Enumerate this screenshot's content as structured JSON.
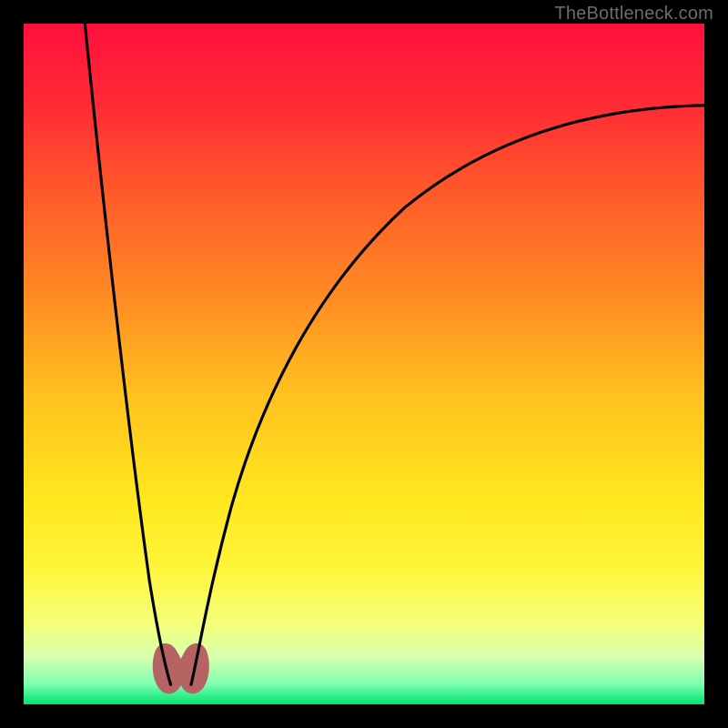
{
  "watermark": "TheBottleneck.com",
  "colors": {
    "black": "#000000",
    "curve_stroke": "#000000",
    "blob": "#b56363",
    "watermark": "#6b6b6b"
  },
  "gradient_stops": [
    {
      "offset": 0.0,
      "color": "#ff103e"
    },
    {
      "offset": 0.12,
      "color": "#ff2b35"
    },
    {
      "offset": 0.25,
      "color": "#ff5a2a"
    },
    {
      "offset": 0.4,
      "color": "#ff8b23"
    },
    {
      "offset": 0.55,
      "color": "#ffc21e"
    },
    {
      "offset": 0.7,
      "color": "#ffe81e"
    },
    {
      "offset": 0.8,
      "color": "#fff53a"
    },
    {
      "offset": 0.88,
      "color": "#f6ff78"
    },
    {
      "offset": 0.93,
      "color": "#d8ffae"
    },
    {
      "offset": 0.97,
      "color": "#7dffb0"
    },
    {
      "offset": 1.0,
      "color": "#00e472"
    }
  ],
  "chart_data": {
    "type": "line",
    "title": "",
    "xlabel": "",
    "ylabel": "",
    "xlim": [
      0,
      100
    ],
    "ylim": [
      0,
      100
    ],
    "series": [
      {
        "name": "left-branch",
        "x": [
          9,
          12.5,
          15,
          17.5,
          20,
          21.5
        ],
        "values": [
          100,
          75,
          50,
          25,
          8,
          0
        ]
      },
      {
        "name": "right-branch",
        "x": [
          24.5,
          27,
          30,
          34,
          40,
          50,
          62,
          78,
          100
        ],
        "values": [
          0,
          15,
          32,
          47,
          60,
          72,
          80,
          85,
          88
        ]
      }
    ],
    "minimum_region_x": [
      20,
      26
    ],
    "annotations": []
  }
}
